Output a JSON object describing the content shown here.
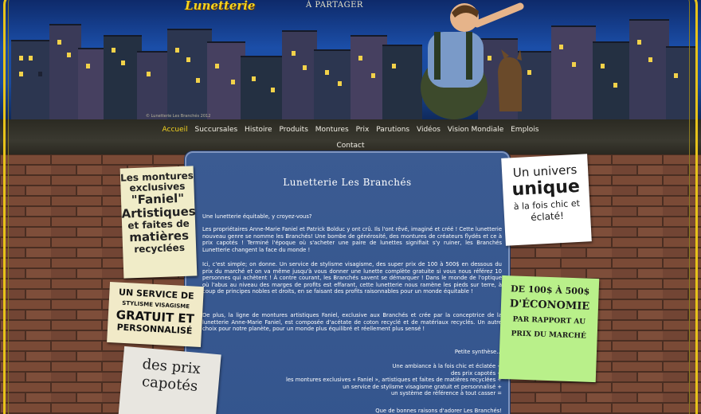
{
  "brand": {
    "logo_text": "Lunetterie",
    "tagline": "À PARTAGER",
    "copyright": "© Lunetterie Les Branchés 2012"
  },
  "nav": {
    "row1": [
      "Accueil",
      "Succursales",
      "Histoire",
      "Produits",
      "Montures",
      "Prix",
      "Parutions",
      "Vidéos",
      "Vision Mondiale",
      "Emplois"
    ],
    "row2": [
      "Contact"
    ],
    "active": "Accueil"
  },
  "colors": {
    "accent": "#f0d020",
    "panel": "#3b5b92",
    "brick": "#7a4a36"
  },
  "main": {
    "title": "Lunetterie Les Branchés",
    "intro": "Une lunetterie équitable, y croyez-vous?",
    "p1": "Les propriétaires Anne-Marie Faniel et Patrick Bolduc y ont crû. Ils l'ont rêvé, imaginé et créé ! Cette lunetterie nouveau genre se nomme les Branchés! Une bombe de générosité, des montures de créateurs flydés et ce à prix capotés ! Terminé l'époque où s'acheter une paire de lunettes signifiait s'y ruiner, les Branchés Lunetterie changent la face du monde !",
    "p2": "Ici, c'est simple; on donne. Un  service de stylisme visagisme, des super prix de 100 à 500$ en dessous du prix du marché et on va même jusqu'à vous donner une lunette complète gratuite si vous nous référez 10 personnes qui achètent ! À contre courant, les Branchés savent se démarquer ! Dans le monde de l'optique où l'abus au niveau des marges de profits est effarant, cette lunetterie nous ramène les pieds sur terre, à coup de principes nobles et droits, en se faisant des profits raisonnables pour un monde équitable !",
    "p3": "De plus, la ligne de montures artistiques Faniel, exclusive aux Branchés et crée par la conceptrice de la lunetterie Anne-Marie Faniel, est composée d'acétate de coton recyclé et de matériaux recyclés. Un autre choix pour notre planète, pour un monde plus équilibré et réellement plus sensé !",
    "summary_heading": "Petite synthèse…",
    "summary": [
      "Une ambiance à la fois chic et éclatée +",
      "des prix capotés +",
      "les montures exclusives « Faniel », artistiques et faites de matières recyclées +",
      "un service de stylisme visagisme gratuit et personnalisé +",
      "un système de référence à tout casser ="
    ],
    "closing": "Que de bonnes raisons d'adorer Les Branchés!"
  },
  "posters": {
    "left1": [
      "Les montures",
      "exclusives",
      "\"Faniel\"",
      "Artistiques",
      "et faites de",
      "matières",
      "recyclées"
    ],
    "left2": [
      "UN SERVICE DE",
      "STYLISME VISAGISME",
      "GRATUIT ET",
      "PERSONNALISÉ"
    ],
    "left3": [
      "des prix",
      "capotés"
    ],
    "right1": [
      "Un univers",
      "unique",
      "à la fois chic et",
      "éclaté!"
    ],
    "right2": [
      "DE 100$ À 500$",
      "D'ÉCONOMIE",
      "PAR RAPPORT AU",
      "PRIX DU MARCHÉ"
    ]
  }
}
